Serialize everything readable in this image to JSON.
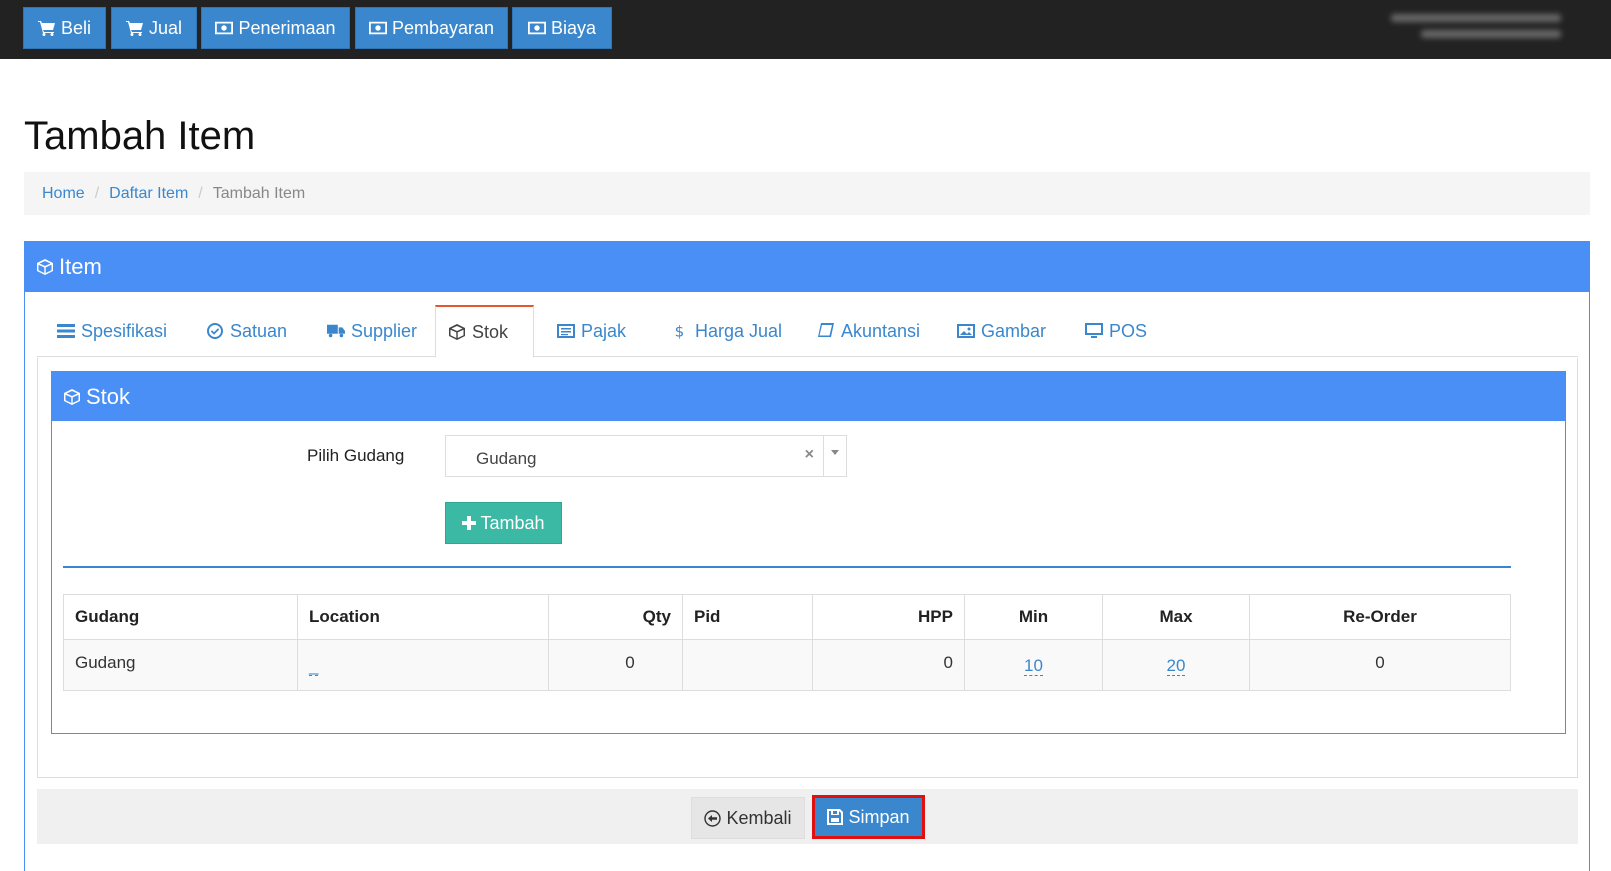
{
  "topnav": {
    "items": [
      {
        "label": "Beli",
        "icon": "cart-icon"
      },
      {
        "label": "Jual",
        "icon": "cart-icon"
      },
      {
        "label": "Penerimaan",
        "icon": "money-icon"
      },
      {
        "label": "Pembayaran",
        "icon": "money-icon"
      },
      {
        "label": "Biaya",
        "icon": "money-icon"
      }
    ]
  },
  "page": {
    "title": "Tambah Item"
  },
  "breadcrumb": {
    "home": "Home",
    "list": "Daftar Item",
    "current": "Tambah Item",
    "separator": "/"
  },
  "panel": {
    "title": "Item"
  },
  "tabs": [
    {
      "label": "Spesifikasi",
      "icon": "list-icon"
    },
    {
      "label": "Satuan",
      "icon": "check-circle-icon"
    },
    {
      "label": "Supplier",
      "icon": "truck-icon"
    },
    {
      "label": "Stok",
      "icon": "cube-icon"
    },
    {
      "label": "Pajak",
      "icon": "list-alt-icon"
    },
    {
      "label": "Harga Jual",
      "icon": "dollar-icon"
    },
    {
      "label": "Akuntansi",
      "icon": "book-icon"
    },
    {
      "label": "Gambar",
      "icon": "image-icon"
    },
    {
      "label": "POS",
      "icon": "monitor-icon"
    }
  ],
  "stok": {
    "title": "Stok",
    "warehouse_label": "Pilih Gudang",
    "warehouse_value": "Gudang",
    "clear_symbol": "×",
    "add_label": "Tambah",
    "table": {
      "headers": [
        "Gudang",
        "Location",
        "Qty",
        "Pid",
        "HPP",
        "Min",
        "Max",
        "Re-Order"
      ],
      "rows": [
        {
          "gudang": "Gudang",
          "location": "_",
          "qty": "0",
          "pid": "",
          "hpp": "0",
          "min": "10",
          "max": "20",
          "reorder": "0"
        }
      ]
    }
  },
  "footer": {
    "back_label": "Kembali",
    "save_label": "Simpan"
  },
  "colors": {
    "primary": "#4a8ff5",
    "button": "#3a87cd",
    "success": "#3bb9a5",
    "highlight": "#e01010",
    "topbar": "#222222"
  }
}
